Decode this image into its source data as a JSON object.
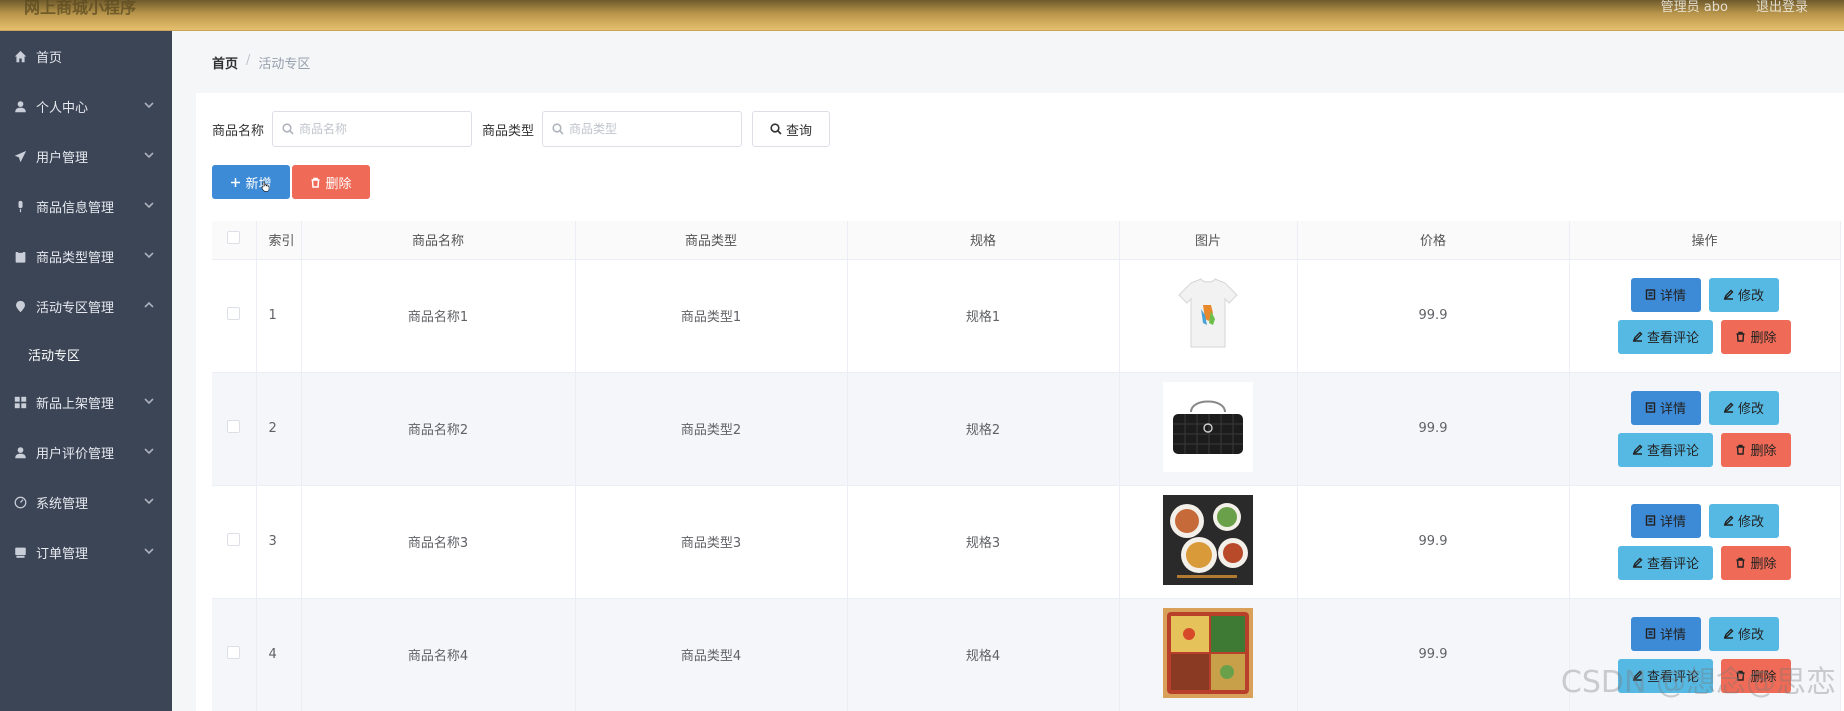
{
  "topbar": {
    "title": "网上商城小程序",
    "admin": "管理员 abo",
    "logout": "退出登录"
  },
  "sidebar": {
    "items": [
      {
        "label": "首页",
        "icon": "home-icon"
      },
      {
        "label": "个人中心",
        "icon": "user-icon"
      },
      {
        "label": "用户管理",
        "icon": "send-icon"
      },
      {
        "label": "商品信息管理",
        "icon": "mic-icon"
      },
      {
        "label": "商品类型管理",
        "icon": "clipboard-icon"
      },
      {
        "label": "活动专区管理",
        "icon": "pin-icon"
      },
      {
        "label": "新品上架管理",
        "icon": "grid-icon"
      },
      {
        "label": "用户评价管理",
        "icon": "user-icon"
      },
      {
        "label": "系统管理",
        "icon": "gauge-icon"
      },
      {
        "label": "订单管理",
        "icon": "box-icon"
      }
    ],
    "sub_item": "活动专区"
  },
  "breadcrumb": {
    "home": "首页",
    "current": "活动专区"
  },
  "search": {
    "name_label": "商品名称",
    "name_placeholder": "商品名称",
    "type_label": "商品类型",
    "type_placeholder": "商品类型",
    "query": "查询"
  },
  "actions": {
    "add": "新增",
    "delete": "删除"
  },
  "table": {
    "headers": [
      "索引",
      "商品名称",
      "商品类型",
      "规格",
      "图片",
      "价格",
      "操作"
    ],
    "rows": [
      {
        "index": "1",
        "name": "商品名称1",
        "type": "商品类型1",
        "spec": "规格1",
        "price": "99.9",
        "image": "tshirt"
      },
      {
        "index": "2",
        "name": "商品名称2",
        "type": "商品类型2",
        "spec": "规格2",
        "price": "99.9",
        "image": "handbag"
      },
      {
        "index": "3",
        "name": "商品名称3",
        "type": "商品类型3",
        "spec": "规格3",
        "price": "99.9",
        "image": "food-bowls"
      },
      {
        "index": "4",
        "name": "商品名称4",
        "type": "商品类型4",
        "spec": "规格4",
        "price": "99.9",
        "image": "bento-box"
      }
    ],
    "ops": {
      "detail": "详情",
      "edit": "修改",
      "review": "查看评论",
      "delete": "删除"
    }
  },
  "watermark": "CSDN @想念@思恋",
  "colors": {
    "primary": "#3d8ad6",
    "info": "#56b9e4",
    "danger": "#ef6b57",
    "sidebar": "#3c4556"
  }
}
